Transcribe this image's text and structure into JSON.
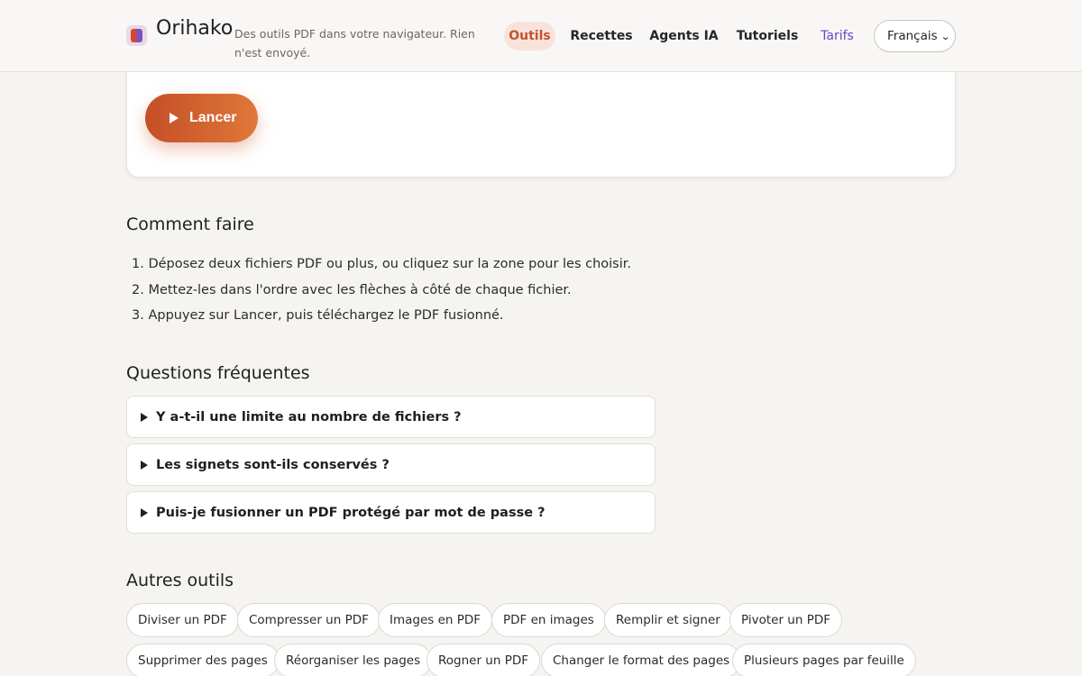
{
  "brand": {
    "name": "Orihako",
    "tagline": "Des outils PDF dans votre navigateur. Rien n'est envoyé."
  },
  "nav": {
    "items": [
      {
        "label": "Outils",
        "active": true
      },
      {
        "label": "Recettes"
      },
      {
        "label": "Agents IA"
      },
      {
        "label": "Tutoriels"
      },
      {
        "label": "Tarifs"
      }
    ],
    "language": {
      "selected": "Français"
    }
  },
  "tool": {
    "run_label": "Lancer"
  },
  "howto": {
    "title": "Comment faire",
    "steps": [
      "1. Déposez deux fichiers PDF ou plus, ou cliquez sur la zone pour les choisir.",
      "2. Mettez-les dans l'ordre avec les flèches à côté de chaque fichier.",
      "3. Appuyez sur Lancer, puis téléchargez le PDF fusionné."
    ]
  },
  "faq": {
    "title": "Questions fréquentes",
    "items": [
      "Y a-t-il une limite au nombre de fichiers ?",
      "Les signets sont-ils conservés ?",
      "Puis-je fusionner un PDF protégé par mot de passe ?"
    ]
  },
  "other_tools": {
    "title": "Autres outils",
    "items": [
      "Diviser un PDF",
      "Compresser un PDF",
      "Images en PDF",
      "PDF en images",
      "Remplir et signer",
      "Pivoter un PDF",
      "Supprimer des pages",
      "Réorganiser les pages",
      "Rogner un PDF",
      "Changer le format des pages",
      "Plusieurs pages par feuille"
    ]
  },
  "colors": {
    "accent": "#c9542d",
    "accent_gradient_end": "#e0783a",
    "pricing_link": "#6a46c4",
    "page_background": "#f6f4f1"
  }
}
